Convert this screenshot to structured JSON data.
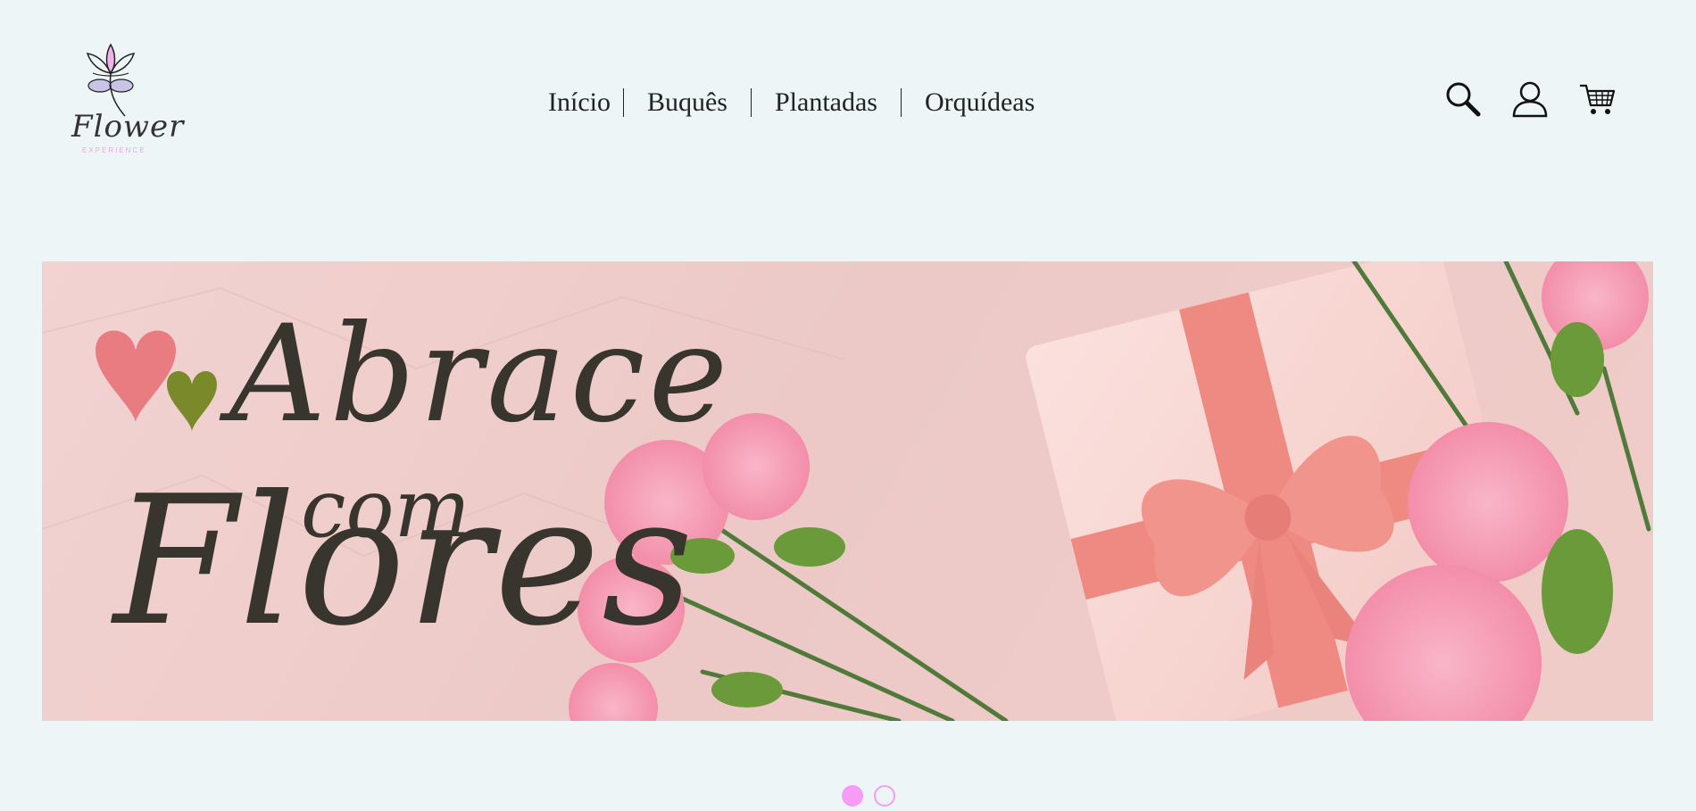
{
  "brand": {
    "name": "Flower",
    "tagline": "EXPERIENCE"
  },
  "nav": {
    "items": [
      {
        "label": "Início"
      },
      {
        "label": "Buquês"
      },
      {
        "label": "Plantadas"
      },
      {
        "label": "Orquídeas"
      }
    ]
  },
  "header_icons": [
    "search-icon",
    "user-icon",
    "cart-icon"
  ],
  "banner": {
    "line1": "Abrace",
    "line2": "com",
    "line3": "Flores"
  },
  "carousel": {
    "slides": 2,
    "active_index": 0
  },
  "colors": {
    "background": "#eef5f6",
    "accent": "#f59cf7",
    "banner_bg": "#efcfcc",
    "heart_pink": "#e87c80",
    "heart_green": "#7a8a2a",
    "ribbon": "#ef8a82"
  }
}
